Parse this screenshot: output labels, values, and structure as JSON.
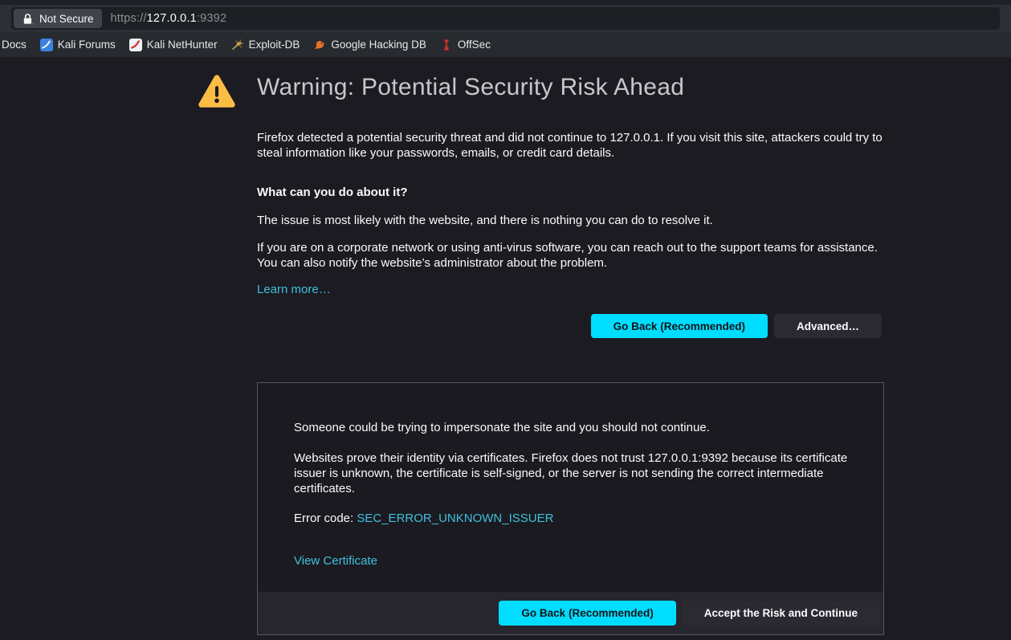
{
  "browser": {
    "identity_chip": "Not Secure",
    "url": {
      "scheme": "https://",
      "host": "127.0.0.1",
      "port": ":9392"
    },
    "bookmarks": [
      {
        "label": "Docs",
        "icon": "none"
      },
      {
        "label": "Kali Forums",
        "icon": "kali-forums-icon"
      },
      {
        "label": "Kali NetHunter",
        "icon": "kali-nethunter-icon"
      },
      {
        "label": "Exploit-DB",
        "icon": "exploit-db-icon"
      },
      {
        "label": "Google Hacking DB",
        "icon": "google-hacking-db-icon"
      },
      {
        "label": "OffSec",
        "icon": "offsec-icon"
      }
    ]
  },
  "page": {
    "title": "Warning: Potential Security Risk Ahead",
    "intro": "Firefox detected a potential security threat and did not continue to 127.0.0.1. If you visit this site, attackers could try to steal information like your passwords, emails, or credit card details.",
    "what_heading": "What can you do about it?",
    "issue_text": "The issue is most likely with the website, and there is nothing you can do to resolve it.",
    "corporate_text": "If you are on a corporate network or using anti-virus software, you can reach out to the support teams for assistance. You can also notify the website’s administrator about the problem.",
    "learn_more": "Learn more…",
    "go_back_label": "Go Back (Recommended)",
    "advanced_label": "Advanced…"
  },
  "advanced_panel": {
    "impersonate_text": "Someone could be trying to impersonate the site and you should not continue.",
    "certificates_text": "Websites prove their identity via certificates. Firefox does not trust 127.0.0.1:9392 because its certificate issuer is unknown, the certificate is self-signed, or the server is not sending the correct intermediate certificates.",
    "error_code_label": "Error code: ",
    "error_code": "SEC_ERROR_UNKNOWN_ISSUER",
    "view_certificate": "View Certificate",
    "go_back_label": "Go Back (Recommended)",
    "accept_label": "Accept the Risk and Continue"
  },
  "colors": {
    "accent_cyan": "#00ddff",
    "link": "#3fc1dd",
    "warning_yellow": "#fcbd45",
    "page_background": "#1c1b22"
  }
}
